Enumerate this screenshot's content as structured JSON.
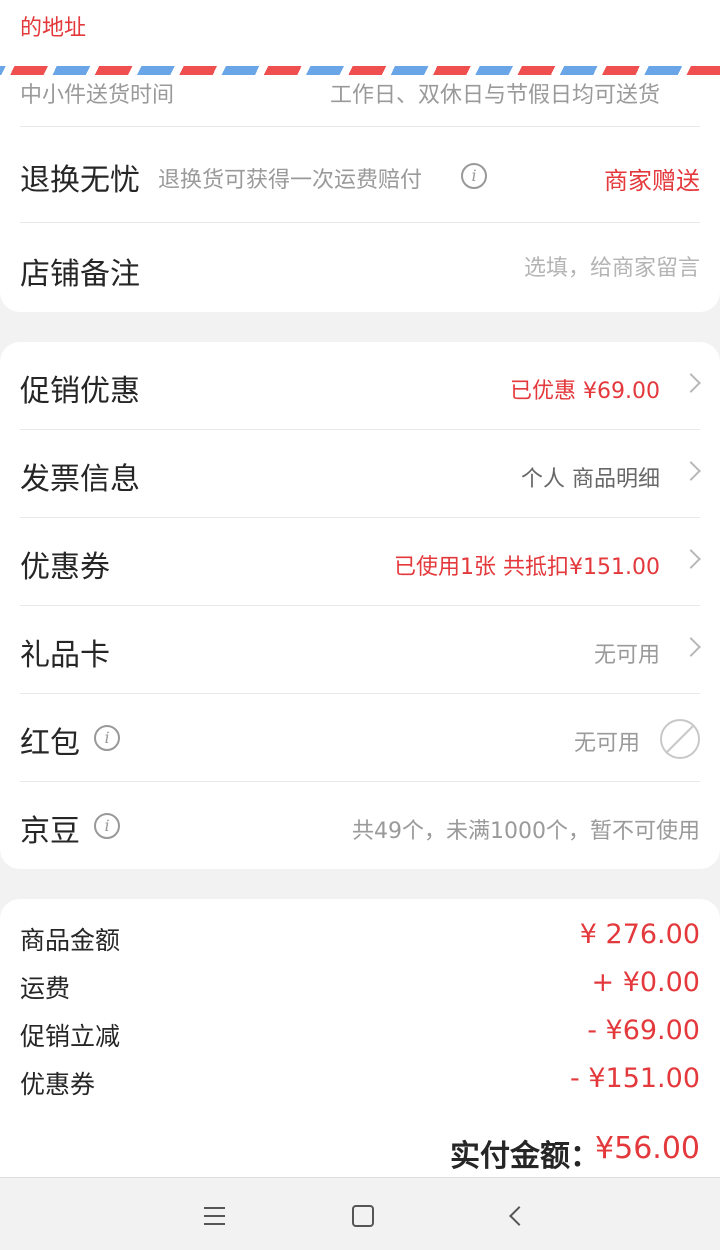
{
  "address": {
    "text_tail": "的地址"
  },
  "delivery": {
    "label": "中小件送货时间",
    "value": "工作日、双休日与节假日均可送货"
  },
  "returns": {
    "title": "退换无忧",
    "desc": "退换货可获得一次运费赔付",
    "gift": "商家赠送"
  },
  "note": {
    "title": "店铺备注",
    "placeholder": "选填，给商家留言",
    "value": ""
  },
  "promo": {
    "title": "促销优惠",
    "value": "已优惠 ¥69.00"
  },
  "invoice": {
    "title": "发票信息",
    "value": "个人 商品明细"
  },
  "coupon": {
    "title": "优惠券",
    "value": "已使用1张 共抵扣¥151.00"
  },
  "giftcard": {
    "title": "礼品卡",
    "value": "无可用"
  },
  "redpacket": {
    "title": "红包",
    "value": "无可用"
  },
  "jingdou": {
    "title": "京豆",
    "value": "共49个，未满1000个，暂不可使用"
  },
  "summary": {
    "rows": [
      {
        "label": "商品金额",
        "value": "¥ 276.00"
      },
      {
        "label": "运费",
        "value": "+ ¥0.00"
      },
      {
        "label": "促销立减",
        "value": "- ¥69.00"
      },
      {
        "label": "优惠券",
        "value": "- ¥151.00"
      }
    ]
  },
  "pay": {
    "label": "实付金额：",
    "amount": "¥56.00"
  },
  "colors": {
    "accent": "#e4393c",
    "text": "#262626",
    "muted": "#9a9a9a",
    "airmail_red": "#ef4f4f",
    "airmail_blue": "#6aa5e8"
  },
  "icons": [
    "info-icon",
    "chevron-right-icon",
    "ban-icon",
    "menu-icon",
    "home-icon",
    "back-icon"
  ]
}
